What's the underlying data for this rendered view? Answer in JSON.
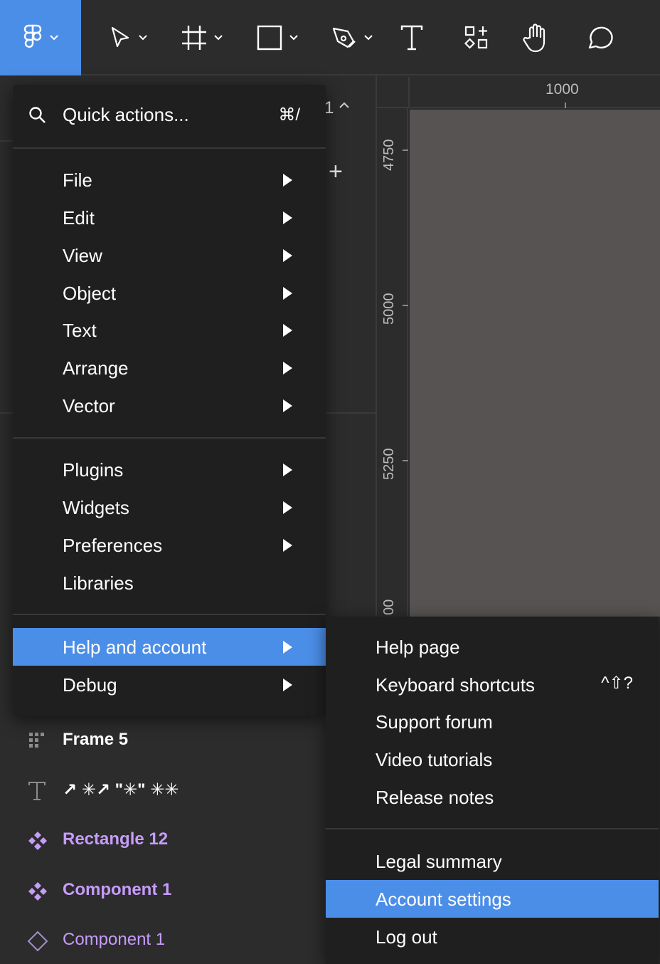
{
  "toolbar": {
    "tools": [
      "main-menu",
      "move-tool",
      "frame-tool",
      "shape-tool",
      "pen-tool",
      "text-tool",
      "resources-tool",
      "hand-tool",
      "comment-tool"
    ]
  },
  "pages": {
    "count": "1",
    "add_label": "+"
  },
  "rulers": {
    "h_label": "1000",
    "v_labels": [
      "4750",
      "5000",
      "5250",
      "00"
    ]
  },
  "menu": {
    "search_label": "Quick actions...",
    "search_shortcut": "⌘/",
    "groups": [
      [
        "File",
        "Edit",
        "View",
        "Object",
        "Text",
        "Arrange",
        "Vector"
      ],
      [
        "Plugins",
        "Widgets",
        "Preferences",
        "Libraries"
      ],
      [
        "Help and account",
        "Debug"
      ]
    ],
    "active_item": "Help and account"
  },
  "submenu": {
    "items_group1": [
      "Help page",
      "Keyboard shortcuts",
      "Support forum",
      "Video tutorials",
      "Release notes"
    ],
    "shortcut_keyboard": "^⇧?",
    "items_group2": [
      "Legal summary",
      "Account settings",
      "Log out"
    ],
    "active_item": "Account settings"
  },
  "layers": [
    {
      "name": "Frame 5",
      "icon": "frame-grid-icon"
    },
    {
      "name": "↗ ✳↗ \"✳\"  ✳✳",
      "icon": "text-icon"
    },
    {
      "name": "Rectangle 12",
      "icon": "component-icon"
    },
    {
      "name": "Component 1",
      "icon": "component-icon"
    },
    {
      "name": "Component 1",
      "icon": "component-instance-icon"
    }
  ],
  "colors": {
    "accent": "#4b8ee8",
    "menu_bg": "#1f1f1f",
    "canvas_bg": "#575353",
    "component_purple": "#c69cfa"
  }
}
